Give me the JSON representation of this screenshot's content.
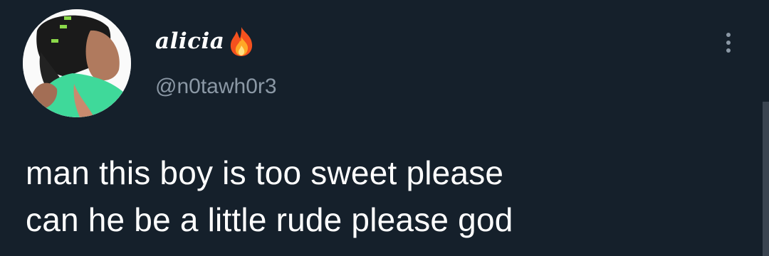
{
  "tweet": {
    "display_name": "alicia",
    "handle": "@n0tawh0r3",
    "text_lines": [
      "man this boy is too sweet please",
      "can he be a little rude please god"
    ]
  },
  "icons": {
    "avatar": "profile-photo",
    "badge": "fire-emoji",
    "menu": "more-vertical-icon"
  },
  "colors": {
    "background": "#15202b",
    "primary_text": "#ffffff",
    "secondary_text": "#8b98a5"
  }
}
